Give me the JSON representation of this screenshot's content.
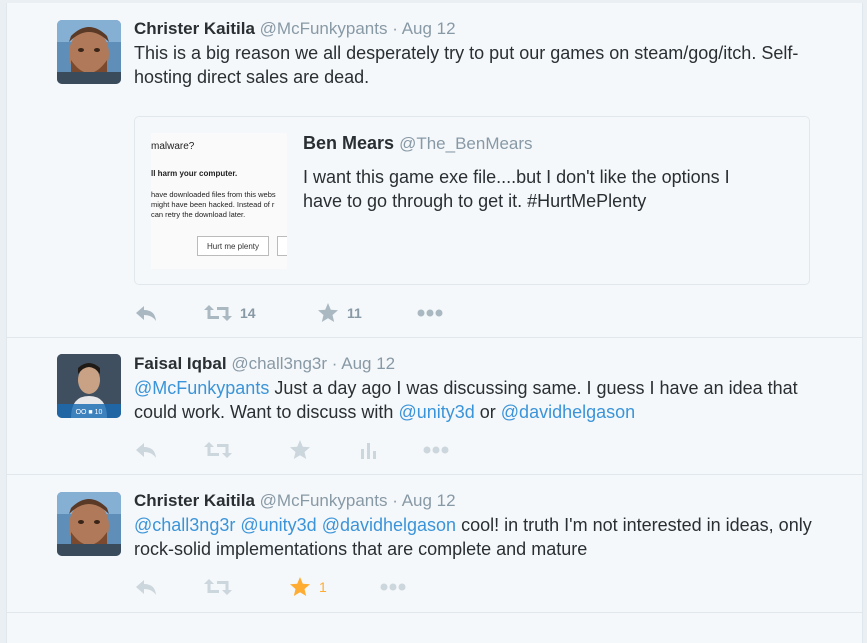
{
  "tweets": [
    {
      "fullname": "Christer Kaitila",
      "screen_name": "@McFunkypants",
      "separator": "·",
      "time": "Aug 12",
      "text": "This is a big reason we all desperately try to put our games on steam/gog/itch. Self-hosting direct sales are dead.",
      "quote": {
        "fullname": "Ben Mears",
        "screen_name": "@The_BenMears",
        "text": "I want this game exe file....but I don't like the options I have to go through to get it. #HurtMePlenty",
        "image": {
          "line1": "malware?",
          "line2": "ll harm your computer.",
          "line3": "have downloaded files from this webs",
          "line4": "might have been hacked. Instead of r",
          "line5": "can retry the download later.",
          "button": "Hurt me plenty"
        }
      },
      "retweet_count": "14",
      "favorite_count": "11"
    },
    {
      "fullname": "Faisal Iqbal",
      "screen_name": "@chall3ng3r",
      "separator": "·",
      "time": "Aug 12",
      "text_mention1": "@McFunkypants",
      "text_part1": " Just a day ago I was discussing same. I guess I have an idea that could work. Want to discuss with ",
      "text_mention2": "@unity3d",
      "text_part2": " or ",
      "text_mention3": "@davidhelgason",
      "avatar_caption": "OO ■ 10"
    },
    {
      "fullname": "Christer Kaitila",
      "screen_name": "@McFunkypants",
      "separator": "·",
      "time": "Aug 12",
      "text_mention1": "@chall3ng3r",
      "text_sp1": " ",
      "text_mention2": "@unity3d",
      "text_sp2": " ",
      "text_mention3": "@davidhelgason",
      "text_part": " cool! in truth I'm not interested in ideas, only rock-solid implementations that are complete and mature",
      "favorite_count": "1"
    }
  ],
  "colors": {
    "accent": "#3b94d9",
    "muted": "#8899a6",
    "favorited": "#ffac33",
    "background": "#f5f8fa"
  }
}
